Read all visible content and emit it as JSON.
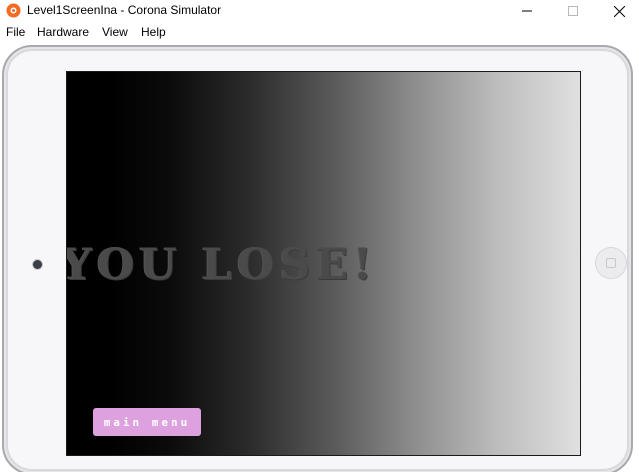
{
  "window": {
    "title": "Level1ScreenIna - Corona Simulator",
    "icon": "corona-app-icon"
  },
  "menubar": {
    "items": [
      {
        "label": "File"
      },
      {
        "label": "Hardware"
      },
      {
        "label": "View"
      },
      {
        "label": "Help"
      }
    ]
  },
  "game": {
    "message": "YOU LOSE!",
    "button_label": "main menu",
    "colors": {
      "button_bg": "#dea1e0",
      "message_color": "#4a4a4a"
    }
  },
  "device": {
    "type": "tablet",
    "color": "#f7f7f9"
  }
}
